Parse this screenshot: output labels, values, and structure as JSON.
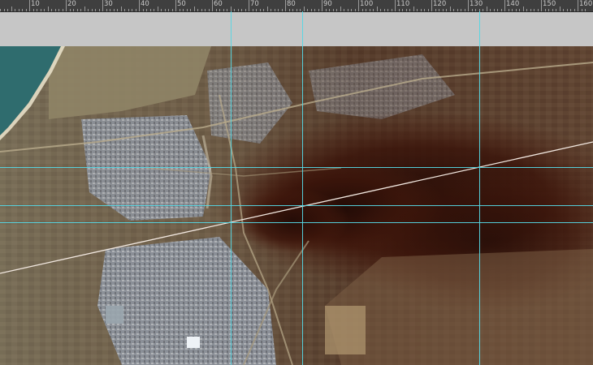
{
  "ruler": {
    "labels": [
      "10",
      "20",
      "30",
      "40",
      "50",
      "60",
      "70",
      "80",
      "90",
      "100",
      "110",
      "120",
      "130",
      "140",
      "150",
      "160"
    ]
  },
  "guides": {
    "vertical_count": 3,
    "horizontal_count": 3,
    "color": "#56d7e4"
  },
  "canvas": {
    "content": "satellite-map"
  },
  "colors": {
    "ruler_bg": "#3f3f3f",
    "pasteboard": "#c6c6c6",
    "sea": "#2f6c6e",
    "smoke": "#2a0f08",
    "measure_line": "#f2e8e0"
  }
}
